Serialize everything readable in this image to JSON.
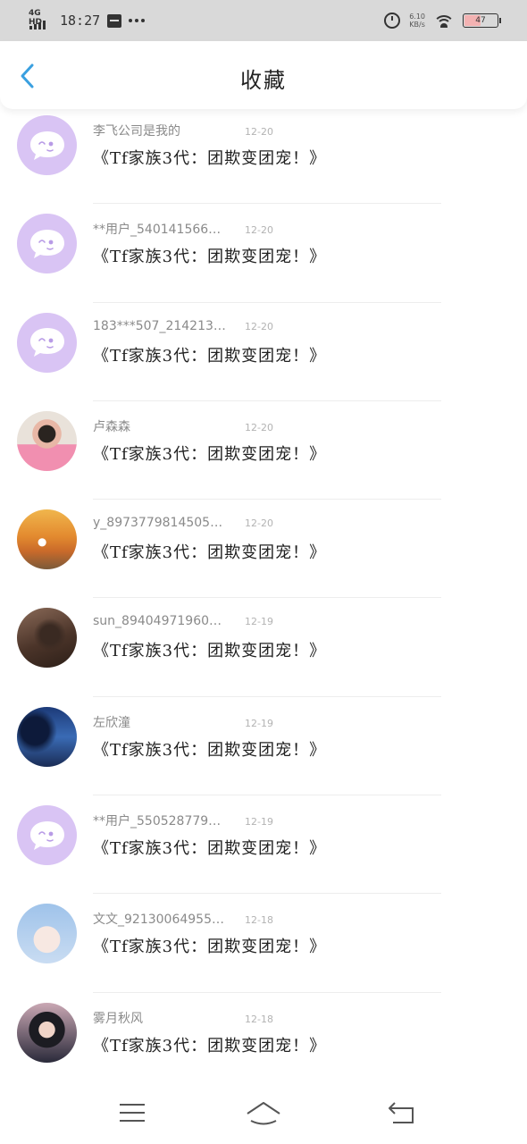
{
  "status_bar": {
    "network": "4G HD",
    "time": "18:27",
    "speed_top": "6.10",
    "speed_bottom": "KB/s",
    "battery": "47",
    "battery_level": 0.47
  },
  "header": {
    "title": "收藏",
    "back_icon": "chevron-left-icon"
  },
  "colors": {
    "accent": "#3aa0e0",
    "default_avatar": "#d9c4f4",
    "status_bar_bg": "#d9d9d9"
  },
  "items": [
    {
      "user": "李飞公司是我的",
      "date": "12-20",
      "content": "《Tf家族3代：团欺变团宠！》",
      "avatar": "default"
    },
    {
      "user": "**用户_54014156684...",
      "date": "12-20",
      "content": "《Tf家族3代：团欺变团宠！》",
      "avatar": "default"
    },
    {
      "user": "183***507_2142139983",
      "date": "12-20",
      "content": "《Tf家族3代：团欺变团宠！》",
      "avatar": "default"
    },
    {
      "user": "卢森森",
      "date": "12-20",
      "content": "《Tf家族3代：团欺变团宠！》",
      "avatar": "photo-pink"
    },
    {
      "user": "y_897377981450521885",
      "date": "12-20",
      "content": "《Tf家族3代：团欺变团宠！》",
      "avatar": "photo-sunset"
    },
    {
      "user": "sun_8940497196089989",
      "date": "12-19",
      "content": "《Tf家族3代：团欺变团宠！》",
      "avatar": "photo-dark"
    },
    {
      "user": "左欣潼",
      "date": "12-19",
      "content": "《Tf家族3代：团欺变团宠！》",
      "avatar": "photo-blue"
    },
    {
      "user": "**用户_55052877975...",
      "date": "12-19",
      "content": "《Tf家族3代：团欺变团宠！》",
      "avatar": "default"
    },
    {
      "user": "文文_9213006495592...",
      "date": "12-18",
      "content": "《Tf家族3代：团欺变团宠！》",
      "avatar": "photo-anime"
    },
    {
      "user": "雾月秋风",
      "date": "12-18",
      "content": "《Tf家族3代：团欺变团宠！》",
      "avatar": "photo-girl"
    }
  ],
  "nav": {
    "menu_icon": "menu-icon",
    "home_icon": "home-icon",
    "back_icon": "return-icon"
  }
}
